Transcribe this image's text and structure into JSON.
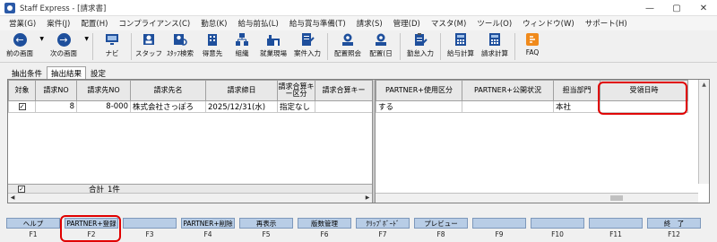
{
  "window": {
    "title": "Staff Express - [請求書]"
  },
  "window_controls": {
    "minimize": "—",
    "maximize": "▢",
    "close": "✕"
  },
  "menu": [
    "営業(G)",
    "案件(J)",
    "配置(H)",
    "コンプライアンス(C)",
    "勤怠(K)",
    "給与前払(L)",
    "給与賞与準備(T)",
    "請求(S)",
    "管理(D)",
    "マスタ(M)",
    "ツール(O)",
    "ウィンドウ(W)",
    "サポート(H)"
  ],
  "toolbar": {
    "back": "前の画面",
    "forward": "次の画面",
    "navi": "ナビ",
    "staff": "スタッフ",
    "staff_search": "ｽﾀｯﾌ検索",
    "client": "得意先",
    "org": "組織",
    "site": "就業現場",
    "case_input": "案件入力",
    "place_inquiry": "配置照会",
    "place_day": "配置(日",
    "attendance_input": "勤怠入力",
    "payroll_calc": "給与計算",
    "billing_calc": "請求計算",
    "faq": "FAQ"
  },
  "tabs": [
    "抽出条件",
    "抽出結果",
    "設定"
  ],
  "active_tab": 1,
  "grid": {
    "left_headers": [
      "対象",
      "請求NO",
      "請求先NO",
      "請求先名",
      "請求締日",
      "請求合算キー区分",
      "請求合算キー"
    ],
    "right_headers": [
      "PARTNER+使用区分",
      "PARTNER+公開状況",
      "担当部門",
      "受領日時"
    ],
    "rows": [
      {
        "target": "✓",
        "bill_no": "8",
        "client_no": "8-000",
        "client_name": "株式会社さっぽろ",
        "closing_date": "2025/12/31(水)",
        "key_type": "指定なし",
        "key": "",
        "partner_use": "する",
        "partner_public": "",
        "dept": "本社",
        "received": ""
      }
    ],
    "footer_check": "✓",
    "total_label": "合計",
    "total_count": "1件"
  },
  "function_keys": [
    {
      "key": "F1",
      "label": "ヘルプ"
    },
    {
      "key": "F2",
      "label": "PARTNER+登録"
    },
    {
      "key": "F3",
      "label": ""
    },
    {
      "key": "F4",
      "label": "PARTNER+削除"
    },
    {
      "key": "F5",
      "label": "再表示"
    },
    {
      "key": "F6",
      "label": "版数管理"
    },
    {
      "key": "F7",
      "label": "ｸﾘｯﾌﾟﾎﾞｰﾄﾞ"
    },
    {
      "key": "F8",
      "label": "プレビュー"
    },
    {
      "key": "F9",
      "label": ""
    },
    {
      "key": "F10",
      "label": ""
    },
    {
      "key": "F11",
      "label": ""
    },
    {
      "key": "F12",
      "label": "終　了"
    }
  ],
  "colors": {
    "fkey_bg": "#b8cde6",
    "highlight": "#e00000",
    "icon_blue": "#1e4f9c"
  }
}
